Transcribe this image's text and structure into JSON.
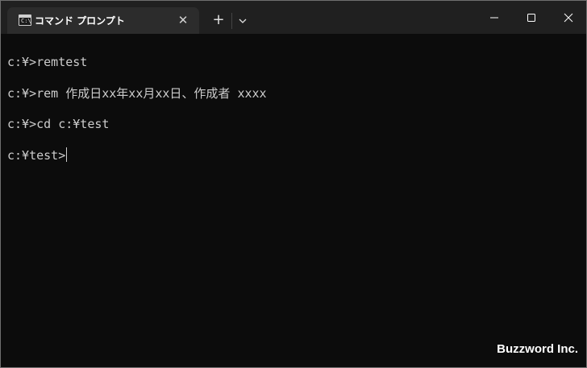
{
  "window": {
    "tab_title": "コマンド プロンプト",
    "tab_icon": "command-prompt-icon",
    "new_tab": "+",
    "close_tab": "✕"
  },
  "terminal": {
    "lines": [
      "c:¥>remtest",
      "c:¥>rem 作成日xx年xx月xx日、作成者 xxxx",
      "c:¥>cd c:¥test",
      "c:¥test>"
    ]
  },
  "watermark": "Buzzword Inc.",
  "colors": {
    "terminal_bg": "#0c0c0c",
    "titlebar_bg": "#202020",
    "tab_bg": "#2c2c2c",
    "text": "#cccccc"
  }
}
